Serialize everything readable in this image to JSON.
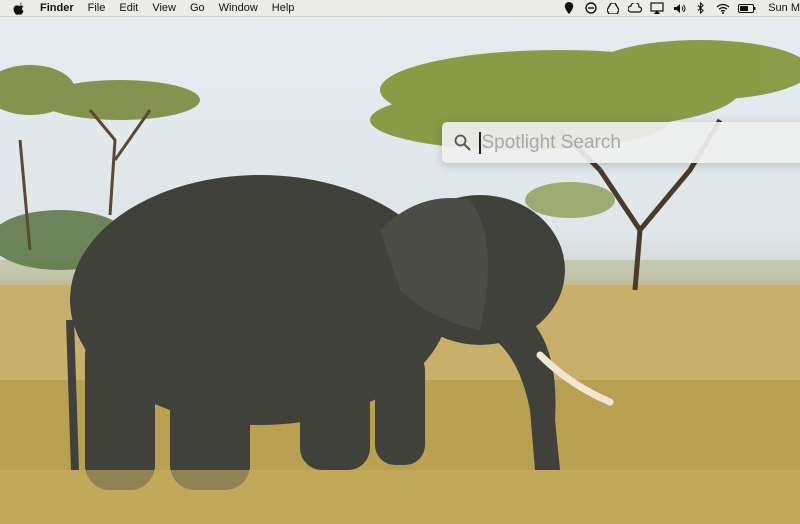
{
  "menubar": {
    "apple_icon": "apple-icon",
    "app_name": "Finder",
    "menus": [
      "File",
      "Edit",
      "View",
      "Go",
      "Window",
      "Help"
    ],
    "status_icons": [
      "location-icon",
      "sync-icon",
      "drive-icon",
      "creative-cloud-icon",
      "airplay-icon",
      "volume-icon",
      "bluetooth-icon",
      "wifi-icon",
      "battery-icon"
    ],
    "clock": "Sun M"
  },
  "spotlight": {
    "placeholder": "Spotlight Search",
    "value": ""
  },
  "wallpaper": {
    "description_icon": "elephant-wallpaper"
  }
}
